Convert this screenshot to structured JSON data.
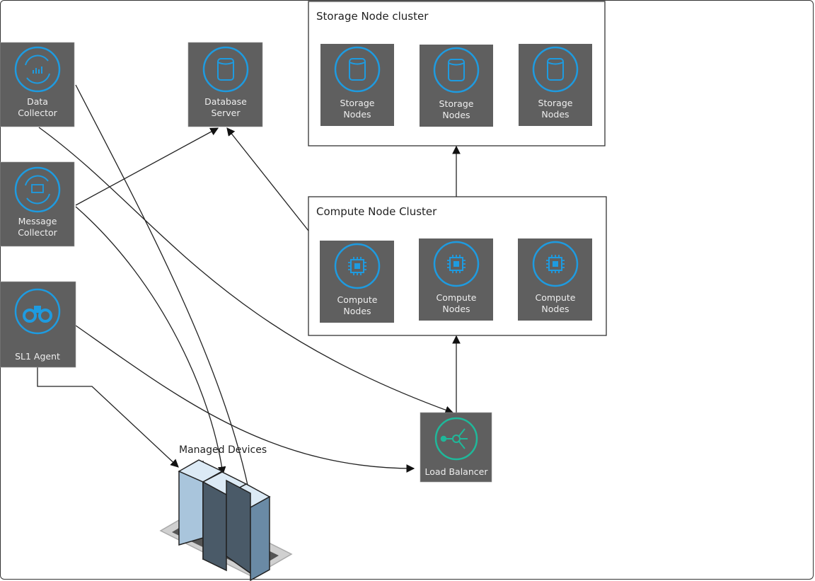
{
  "nodes": {
    "data_collector": [
      "Data",
      "Collector"
    ],
    "message_collector": [
      "Message",
      "Collector"
    ],
    "sl1_agent": [
      "SL1 Agent"
    ],
    "database_server": [
      "Database",
      "Server"
    ],
    "load_balancer": [
      "Load Balancer"
    ],
    "managed_devices": "Managed Devices"
  },
  "storage_cluster": {
    "title": "Storage Node cluster",
    "nodes": [
      [
        "Storage",
        "Nodes"
      ],
      [
        "Storage",
        "Nodes"
      ],
      [
        "Storage",
        "Nodes"
      ]
    ]
  },
  "compute_cluster": {
    "title": "Compute Node Cluster",
    "nodes": [
      [
        "Compute",
        "Nodes"
      ],
      [
        "Compute",
        "Nodes"
      ],
      [
        "Compute",
        "Nodes"
      ]
    ]
  },
  "colors": {
    "tile": "#5f5f5f",
    "icon_blue": "#1e9be0",
    "icon_green": "#1fb89a",
    "line": "#222222"
  },
  "icons": {
    "data_collector": "cycle-chart-icon",
    "message_collector": "cycle-message-icon",
    "sl1_agent": "binoculars-icon",
    "database_server": "database-icon",
    "storage": "database-icon",
    "compute": "chip-icon",
    "load_balancer": "load-balancer-icon",
    "managed_devices": "server-rack-icon"
  }
}
